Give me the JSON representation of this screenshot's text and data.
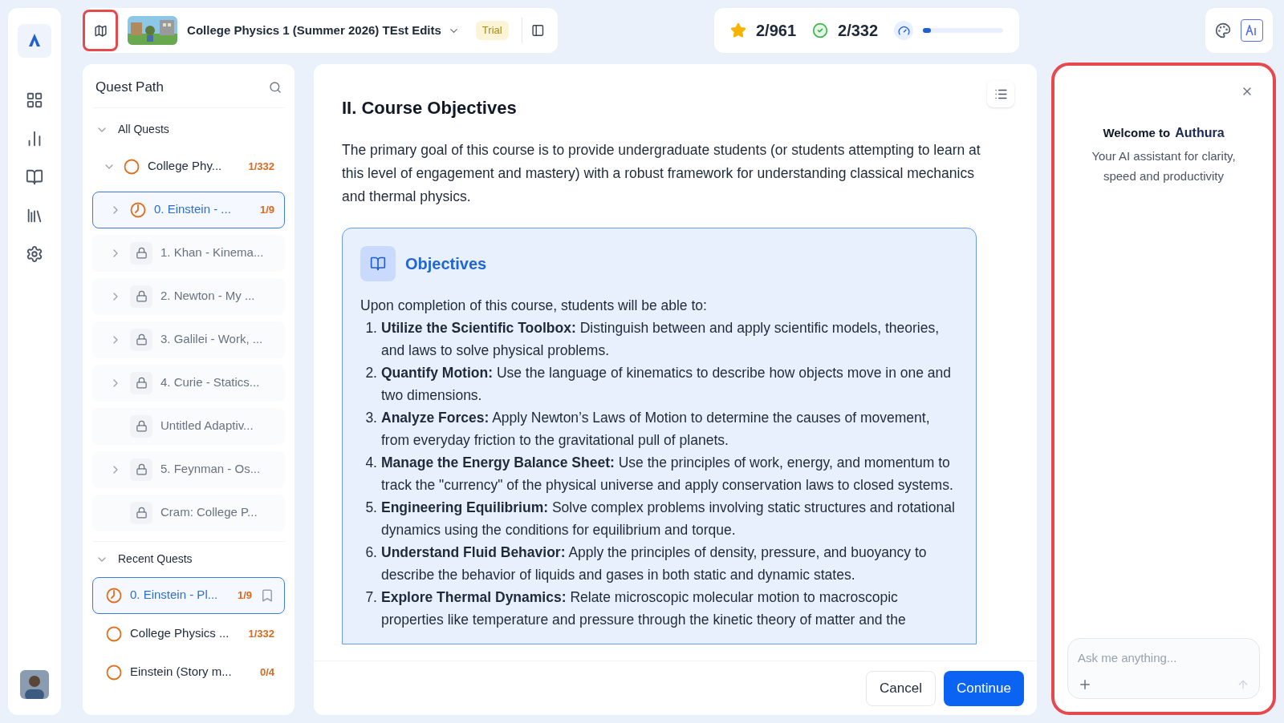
{
  "rail": {
    "items": [
      {
        "kind": "dashboard",
        "selected": false
      },
      {
        "kind": "analytics",
        "selected": false
      },
      {
        "kind": "book",
        "selected": false
      },
      {
        "kind": "library",
        "selected": false
      },
      {
        "kind": "settings",
        "selected": false
      }
    ]
  },
  "course_bar": {
    "map_highlighted": true,
    "title": "College Physics 1 (Summer 2026) TEst Edits",
    "badge": "Trial"
  },
  "stats": {
    "stars": "2/961",
    "completed": "2/332",
    "progress": {
      "level": 0.1
    }
  },
  "quest_path": {
    "title": "Quest Path",
    "all_quests": {
      "label": "All Quests",
      "expanded": true,
      "items": [
        {
          "label": "College Phy...",
          "count": "1/332",
          "kind": "open",
          "selected": false,
          "expanded": true,
          "children": [
            {
              "label": "0. Einstein - ...",
              "count": "1/9",
              "kind": "progress",
              "selected": true,
              "expanded": false
            },
            {
              "label": "1. Khan - Kinema...",
              "kind": "locked",
              "selected": false,
              "expanded": false
            },
            {
              "label": "2. Newton - My ...",
              "kind": "locked",
              "selected": false,
              "expanded": false
            },
            {
              "label": "3. Galilei - Work, ...",
              "kind": "locked",
              "selected": false,
              "expanded": false
            },
            {
              "label": "4. Curie - Statics...",
              "kind": "locked",
              "selected": false,
              "expanded": false
            },
            {
              "label": "Untitled Adaptiv...",
              "kind": "locked",
              "selected": false
            },
            {
              "label": "5. Feynman - Os...",
              "kind": "locked",
              "selected": false,
              "expanded": false
            },
            {
              "label": "Cram: College P...",
              "kind": "locked",
              "selected": false
            }
          ]
        }
      ]
    },
    "recent_quests": {
      "label": "Recent Quests",
      "expanded": true,
      "items": [
        {
          "label": "0. Einstein - Pl...",
          "count": "1/9",
          "kind": "progress",
          "selected": true,
          "bookmark": true
        },
        {
          "label": "College Physics ...",
          "count": "1/332",
          "kind": "open",
          "selected": false,
          "bookmark": false
        },
        {
          "label": "Einstein (Story m...",
          "count": "0/4",
          "kind": "open",
          "selected": false,
          "bookmark": false
        }
      ]
    }
  },
  "content": {
    "heading": "II. Course Objectives",
    "intro": "The primary goal of this course is to provide undergraduate students (or students attempting to learn at this level of engagement and mastery) with a robust framework for understanding classical mechanics and thermal physics.",
    "objectives": {
      "title": "Objectives",
      "lead": "Upon completion of this course, students will be able to:",
      "items": [
        {
          "number": "1.",
          "term": "Utilize the Scientific Toolbox:",
          "text": "Distinguish between and apply scientific models, theories, and laws to solve physical problems."
        },
        {
          "number": "2.",
          "term": "Quantify Motion:",
          "text": "Use the language of kinematics to describe how objects move in one and two dimensions."
        },
        {
          "number": "3.",
          "term": "Analyze Forces:",
          "text": "Apply Newton’s Laws of Motion to determine the causes of movement, from everyday friction to the gravitational pull of planets."
        },
        {
          "number": "4.",
          "term": "Manage the Energy Balance Sheet:",
          "text": "Use the principles of work, energy, and momentum to track the \"currency\" of the physical universe and apply conservation laws to closed systems."
        },
        {
          "number": "5.",
          "term": "Engineering Equilibrium:",
          "text": "Solve complex problems involving static structures and rotational dynamics using the conditions for equilibrium and torque."
        },
        {
          "number": "6.",
          "term": "Understand Fluid Behavior:",
          "text": "Apply the principles of density, pressure, and buoyancy to describe the behavior of liquids and gases in both static and dynamic states."
        },
        {
          "number": "7.",
          "term": "Explore Thermal Dynamics:",
          "text": "Relate microscopic molecular motion to macroscopic properties like temperature and pressure through the kinetic theory of matter and the"
        }
      ]
    },
    "buttons": [
      {
        "label": "Cancel",
        "kind": "secondary"
      },
      {
        "label": "Continue",
        "kind": "primary"
      }
    ]
  },
  "assistant": {
    "highlighted": true,
    "welcome": "Welcome to",
    "brand": "Authura",
    "subtitle": "Your AI assistant for clarity, speed and productivity",
    "input": {
      "placeholder": "Ask me anything..."
    }
  }
}
